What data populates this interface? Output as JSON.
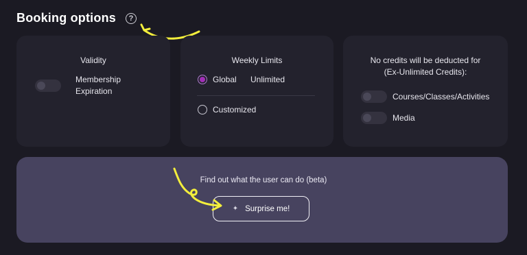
{
  "header": {
    "title": "Booking options",
    "help_icon": "question-circle-icon",
    "help_glyph": "?"
  },
  "validity": {
    "title": "Validity",
    "toggle_label_line1": "Membership",
    "toggle_label_line2": "Expiration",
    "toggle_on": false
  },
  "weekly_limits": {
    "title": "Weekly Limits",
    "options": [
      {
        "label": "Global",
        "value": "Unlimited",
        "selected": true
      },
      {
        "label": "Customized",
        "selected": false
      }
    ]
  },
  "credits": {
    "title_line1": "No credits will be deducted for",
    "title_line2": "(Ex-Unlimited Credits):",
    "toggles": [
      {
        "label": "Courses/Classes/Activities",
        "on": false
      },
      {
        "label": "Media",
        "on": false
      }
    ]
  },
  "beta": {
    "text": "Find out what the user can do (beta)",
    "button_label": "Surprise me!",
    "button_icon": "sparkle-icon",
    "sparkle_glyph": "✦"
  },
  "colors": {
    "background": "#1b1a23",
    "card": "#23222d",
    "beta_panel": "#47435f",
    "accent_purple": "#a22fb7",
    "annotation_yellow": "#f3ee3c"
  }
}
